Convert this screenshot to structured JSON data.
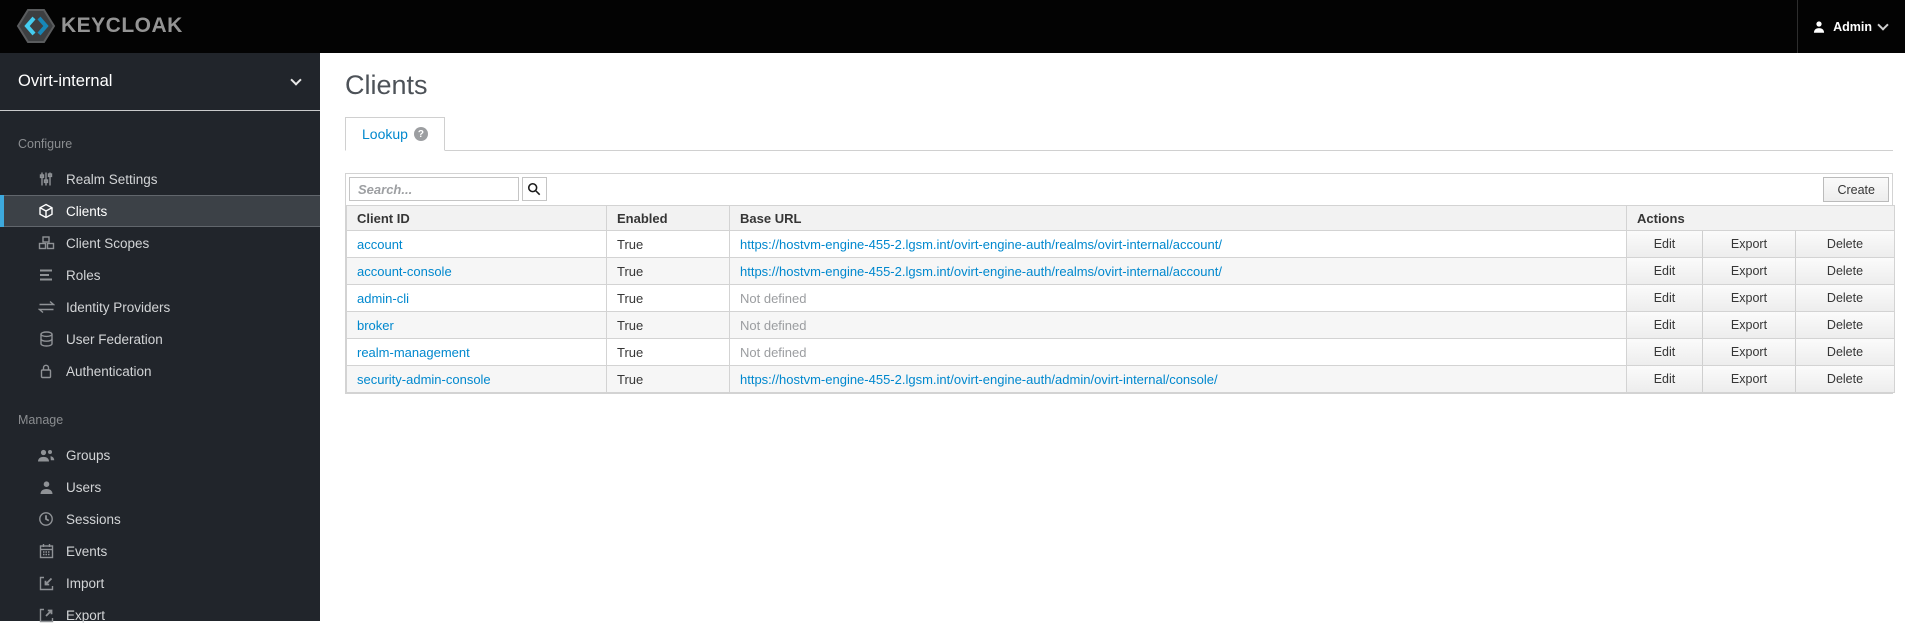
{
  "topbar": {
    "brand": "KEYCLOAK",
    "user": {
      "label": "Admin"
    }
  },
  "sidebar": {
    "realm": "Ovirt-internal",
    "sections": [
      {
        "label": "Configure",
        "items": [
          {
            "label": "Realm Settings",
            "icon": "sliders-icon",
            "active": false
          },
          {
            "label": "Clients",
            "icon": "cube-icon",
            "active": true
          },
          {
            "label": "Client Scopes",
            "icon": "cubes-icon",
            "active": false
          },
          {
            "label": "Roles",
            "icon": "list-icon",
            "active": false
          },
          {
            "label": "Identity Providers",
            "icon": "exchange-icon",
            "active": false
          },
          {
            "label": "User Federation",
            "icon": "database-icon",
            "active": false
          },
          {
            "label": "Authentication",
            "icon": "lock-icon",
            "active": false
          }
        ]
      },
      {
        "label": "Manage",
        "items": [
          {
            "label": "Groups",
            "icon": "users-icon",
            "active": false
          },
          {
            "label": "Users",
            "icon": "user-icon",
            "active": false
          },
          {
            "label": "Sessions",
            "icon": "clock-icon",
            "active": false
          },
          {
            "label": "Events",
            "icon": "calendar-icon",
            "active": false
          },
          {
            "label": "Import",
            "icon": "import-icon",
            "active": false
          },
          {
            "label": "Export",
            "icon": "export-icon",
            "active": false
          }
        ]
      }
    ]
  },
  "main": {
    "title": "Clients",
    "tab": {
      "label": "Lookup",
      "help_icon": "question-icon"
    },
    "toolbar": {
      "search_placeholder": "Search...",
      "create_label": "Create"
    },
    "table": {
      "headers": [
        "Client ID",
        "Enabled",
        "Base URL",
        "Actions"
      ],
      "action_labels": [
        "Edit",
        "Export",
        "Delete"
      ],
      "rows": [
        {
          "client_id": "account",
          "enabled": "True",
          "base_url": "https://hostvm-engine-455-2.lgsm.int/ovirt-engine-auth/realms/ovirt-internal/account/",
          "base_url_defined": true
        },
        {
          "client_id": "account-console",
          "enabled": "True",
          "base_url": "https://hostvm-engine-455-2.lgsm.int/ovirt-engine-auth/realms/ovirt-internal/account/",
          "base_url_defined": true
        },
        {
          "client_id": "admin-cli",
          "enabled": "True",
          "base_url": "Not defined",
          "base_url_defined": false
        },
        {
          "client_id": "broker",
          "enabled": "True",
          "base_url": "Not defined",
          "base_url_defined": false
        },
        {
          "client_id": "realm-management",
          "enabled": "True",
          "base_url": "Not defined",
          "base_url_defined": false
        },
        {
          "client_id": "security-admin-console",
          "enabled": "True",
          "base_url": "https://hostvm-engine-455-2.lgsm.int/ovirt-engine-auth/admin/ovirt-internal/console/",
          "base_url_defined": true
        }
      ]
    }
  },
  "colors": {
    "topbar_bg": "#030303",
    "sidebar_bg": "#21252b",
    "sidebar_active_bar": "#3da9dd",
    "link_blue": "#0088ce",
    "brand_cyan_light": "#45cdf0",
    "brand_cyan_dark": "#1787b8",
    "muted_text": "#9b9da0"
  }
}
